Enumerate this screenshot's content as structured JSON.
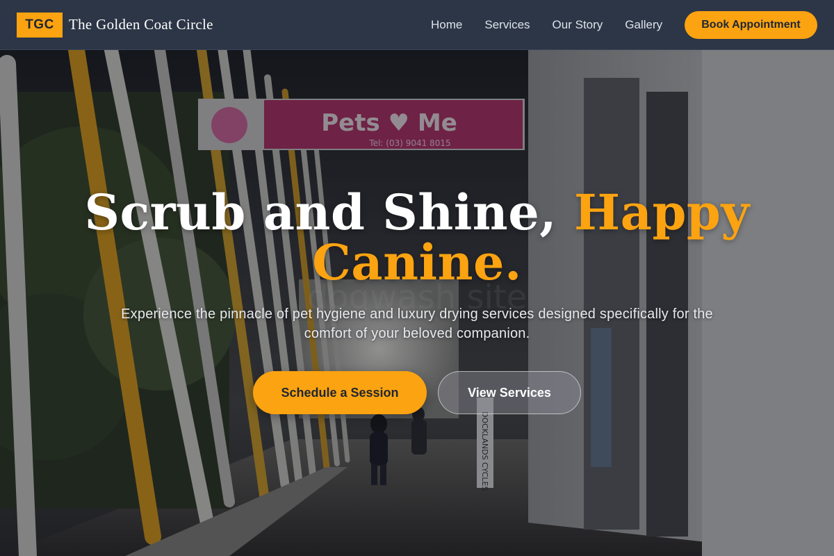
{
  "brand": {
    "badge": "TGC",
    "name": "The Golden Coat Circle",
    "accent_color": "#fca311",
    "nav_bg_color": "#2c3646"
  },
  "nav": {
    "links": [
      {
        "label": "Home"
      },
      {
        "label": "Services"
      },
      {
        "label": "Our Story"
      },
      {
        "label": "Gallery"
      }
    ],
    "cta_label": "Book Appointment"
  },
  "hero": {
    "headline_white": "Scrub and Shine,",
    "headline_accent": "Happy Canine.",
    "subtitle": "Experience the pinnacle of pet hygiene and luxury drying services designed specifically for the comfort of your beloved companion.",
    "primary_cta": "Schedule a Session",
    "secondary_cta": "View Services",
    "background": {
      "sign_text": "Pets ♥ Me",
      "sign_phone": "Tel: (03) 9041 8015",
      "watermark": "dogwash site",
      "shop_sign": "DOCKLANDS CYCLES"
    }
  }
}
